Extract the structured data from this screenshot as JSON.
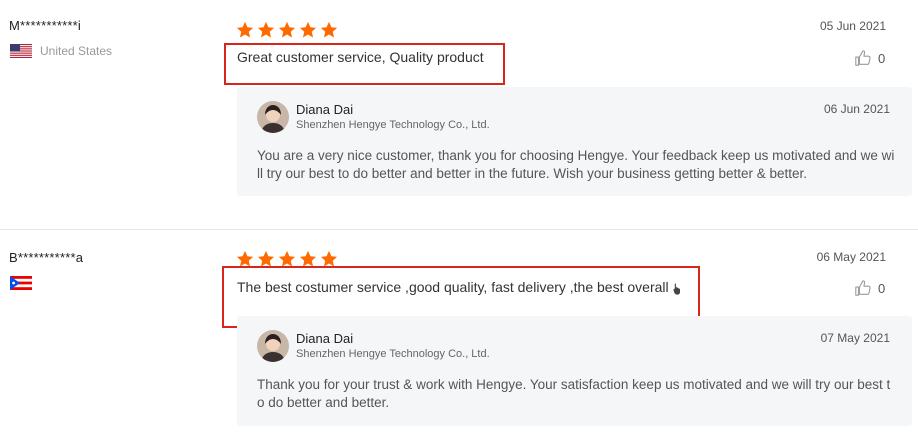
{
  "colors": {
    "star": "#ff6a00",
    "highlight": "#d9261c",
    "reply_bg": "#f5f6f8"
  },
  "reviews": [
    {
      "buyer": "M***********i",
      "country": "United States",
      "flag_icon": "us-flag-icon",
      "rating": 5,
      "date": "05 Jun 2021",
      "text": "Great customer service, Quality product",
      "helpful_count": "0",
      "reply": {
        "seller": "Diana Dai",
        "company": "Shenzhen Hengye Technology Co., Ltd.",
        "date": "06 Jun 2021",
        "text": "You are a very nice customer, thank you for choosing Hengye. Your feedback keep us motivated and we will try our best to do better and better in the future. Wish your business getting better & better."
      }
    },
    {
      "buyer": "B***********a",
      "country": "",
      "flag_icon": "puerto-rico-flag-icon",
      "rating": 5,
      "date": "06 May 2021",
      "text": "The best costumer service ,good quality, fast delivery ,the best overall",
      "helpful_count": "0",
      "reply": {
        "seller": "Diana Dai",
        "company": "Shenzhen Hengye Technology Co., Ltd.",
        "date": "07 May 2021",
        "text": "Thank you for your trust & work with Hengye. Your satisfaction keep us motivated and we will try our best to do better and better."
      }
    }
  ]
}
